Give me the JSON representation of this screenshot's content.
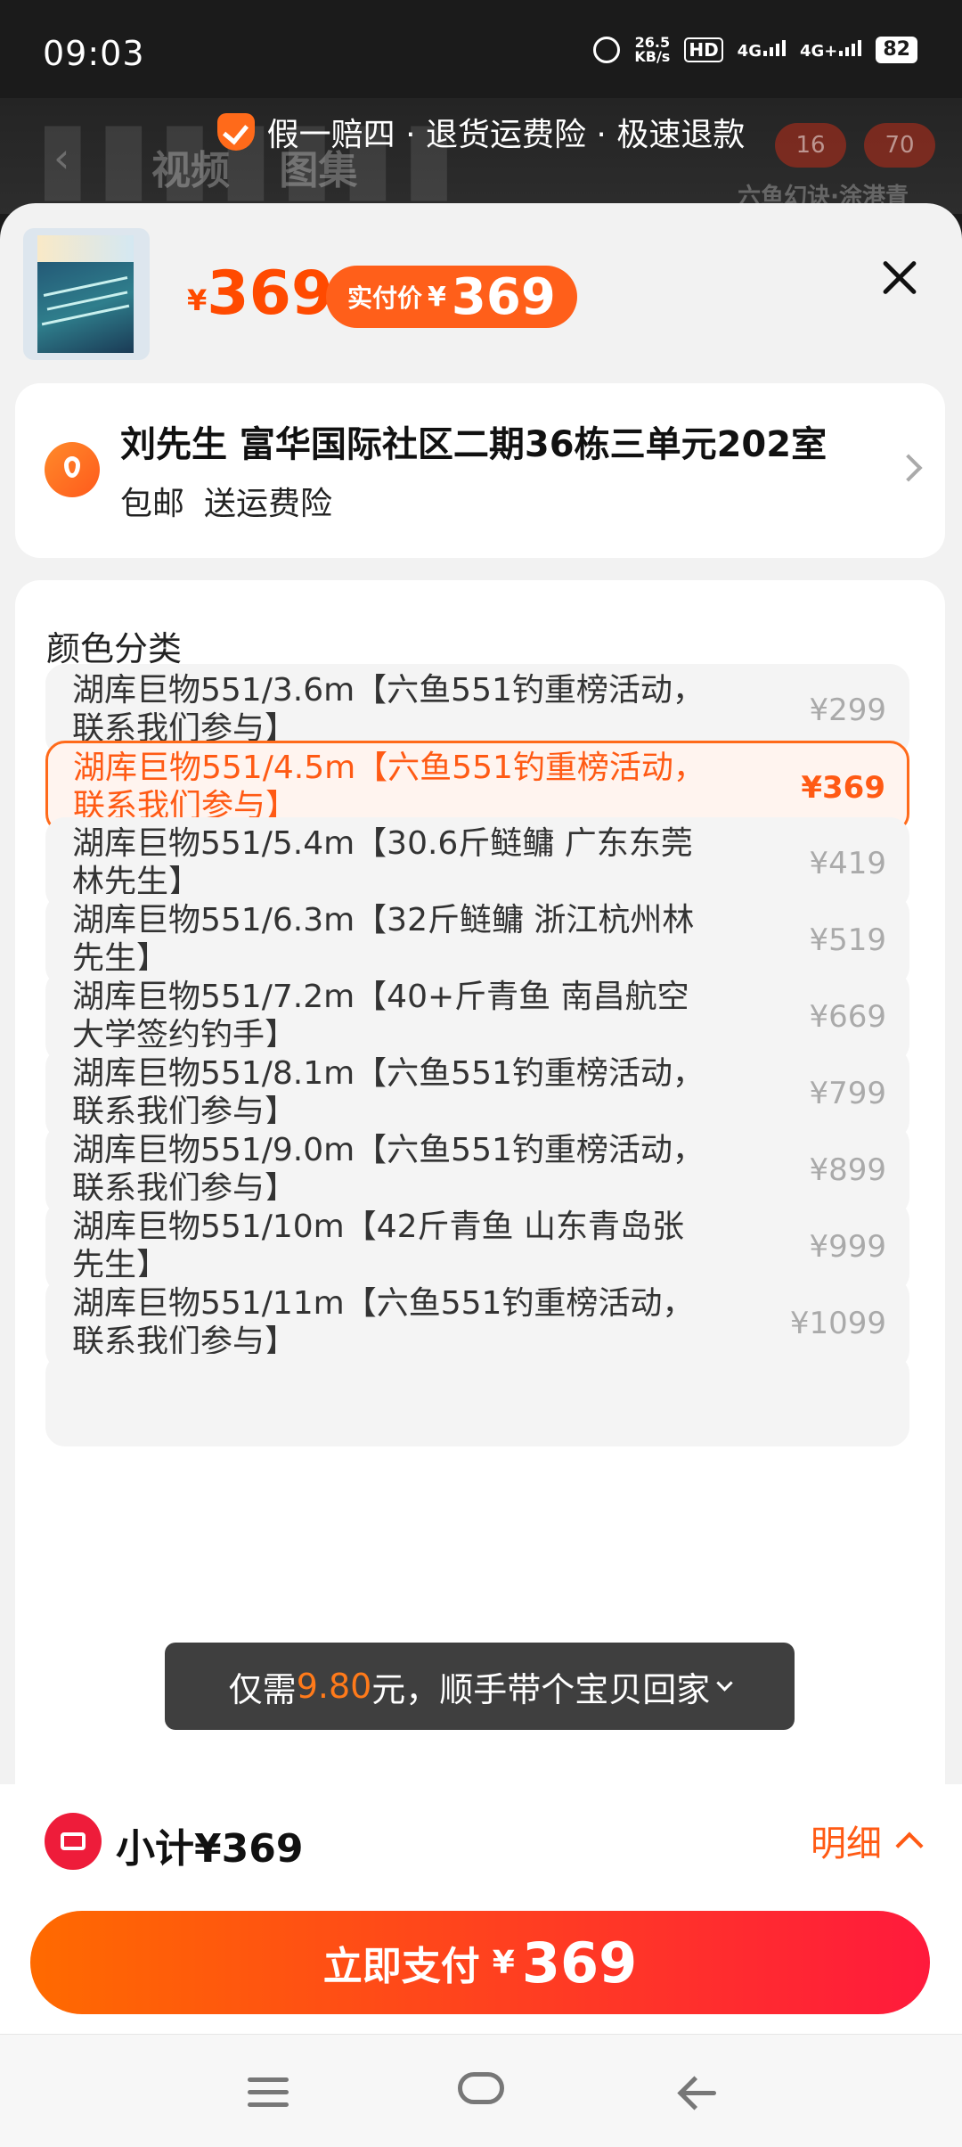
{
  "status_bar": {
    "time": "09:03",
    "net_speed_value": "26.5",
    "net_speed_unit": "KB/s",
    "hd_label": "HD",
    "signal_1": "4G",
    "signal_2": "4G+",
    "battery": "82"
  },
  "background_page": {
    "tab_video": "视频",
    "tab_image": "图集",
    "badge_1": "16",
    "badge_2": "70",
    "sub_text": "六鱼幻诀·涂港青"
  },
  "guarantee_text": "假一赔四 · 退货运费险 · 极速退款",
  "header": {
    "currency": "¥",
    "price": "369",
    "pay_label": "实付价",
    "pay_currency": "¥",
    "pay_amount": "369"
  },
  "address": {
    "name_line": "刘先生 富华国际社区二期36栋三单元202室",
    "tag_shipping": "包邮",
    "tag_insurance": "送运费险"
  },
  "options": {
    "title": "颜色分类",
    "items": [
      {
        "label": "湖库巨物551/3.6m【六鱼551钓重榜活动，联系我们参与】",
        "price": "¥299"
      },
      {
        "label": "湖库巨物551/4.5m【六鱼551钓重榜活动，联系我们参与】",
        "price": "¥369"
      },
      {
        "label": "湖库巨物551/5.4m【30.6斤鲢鳙 广东东莞林先生】",
        "price": "¥419"
      },
      {
        "label": "湖库巨物551/6.3m【32斤鲢鳙 浙江杭州林先生】",
        "price": "¥519"
      },
      {
        "label": "湖库巨物551/7.2m【40+斤青鱼 南昌航空大学签约钓手】",
        "price": "¥669"
      },
      {
        "label": "湖库巨物551/8.1m【六鱼551钓重榜活动，联系我们参与】",
        "price": "¥799"
      },
      {
        "label": "湖库巨物551/9.0m【六鱼551钓重榜活动，联系我们参与】",
        "price": "¥899"
      },
      {
        "label": "湖库巨物551/10m【42斤青鱼 山东青岛张先生】",
        "price": "¥999"
      },
      {
        "label": "湖库巨物551/11m【六鱼551钓重榜活动，联系我们参与】",
        "price": "¥1099"
      }
    ]
  },
  "toast": {
    "prefix": "仅需",
    "amount": "9.80",
    "suffix": "元，顺手带个宝贝回家"
  },
  "footer": {
    "subtotal": "小计¥369",
    "detail_label": "明细",
    "pay_button_text": "立即支付",
    "pay_button_currency": "¥",
    "pay_button_amount": "369"
  },
  "colors": {
    "accent": "#ff5a14",
    "pay_gradient_start": "#ff6a00",
    "pay_gradient_end": "#ff1a3c",
    "coupon_red": "#ee1c3a"
  },
  "icons": [
    "alarm-icon",
    "shield-check-icon",
    "close-icon",
    "location-icon",
    "chevron-right-icon",
    "chevron-down-icon",
    "coupon-icon",
    "chevron-up-icon",
    "menu-icon",
    "home-icon",
    "back-icon"
  ]
}
